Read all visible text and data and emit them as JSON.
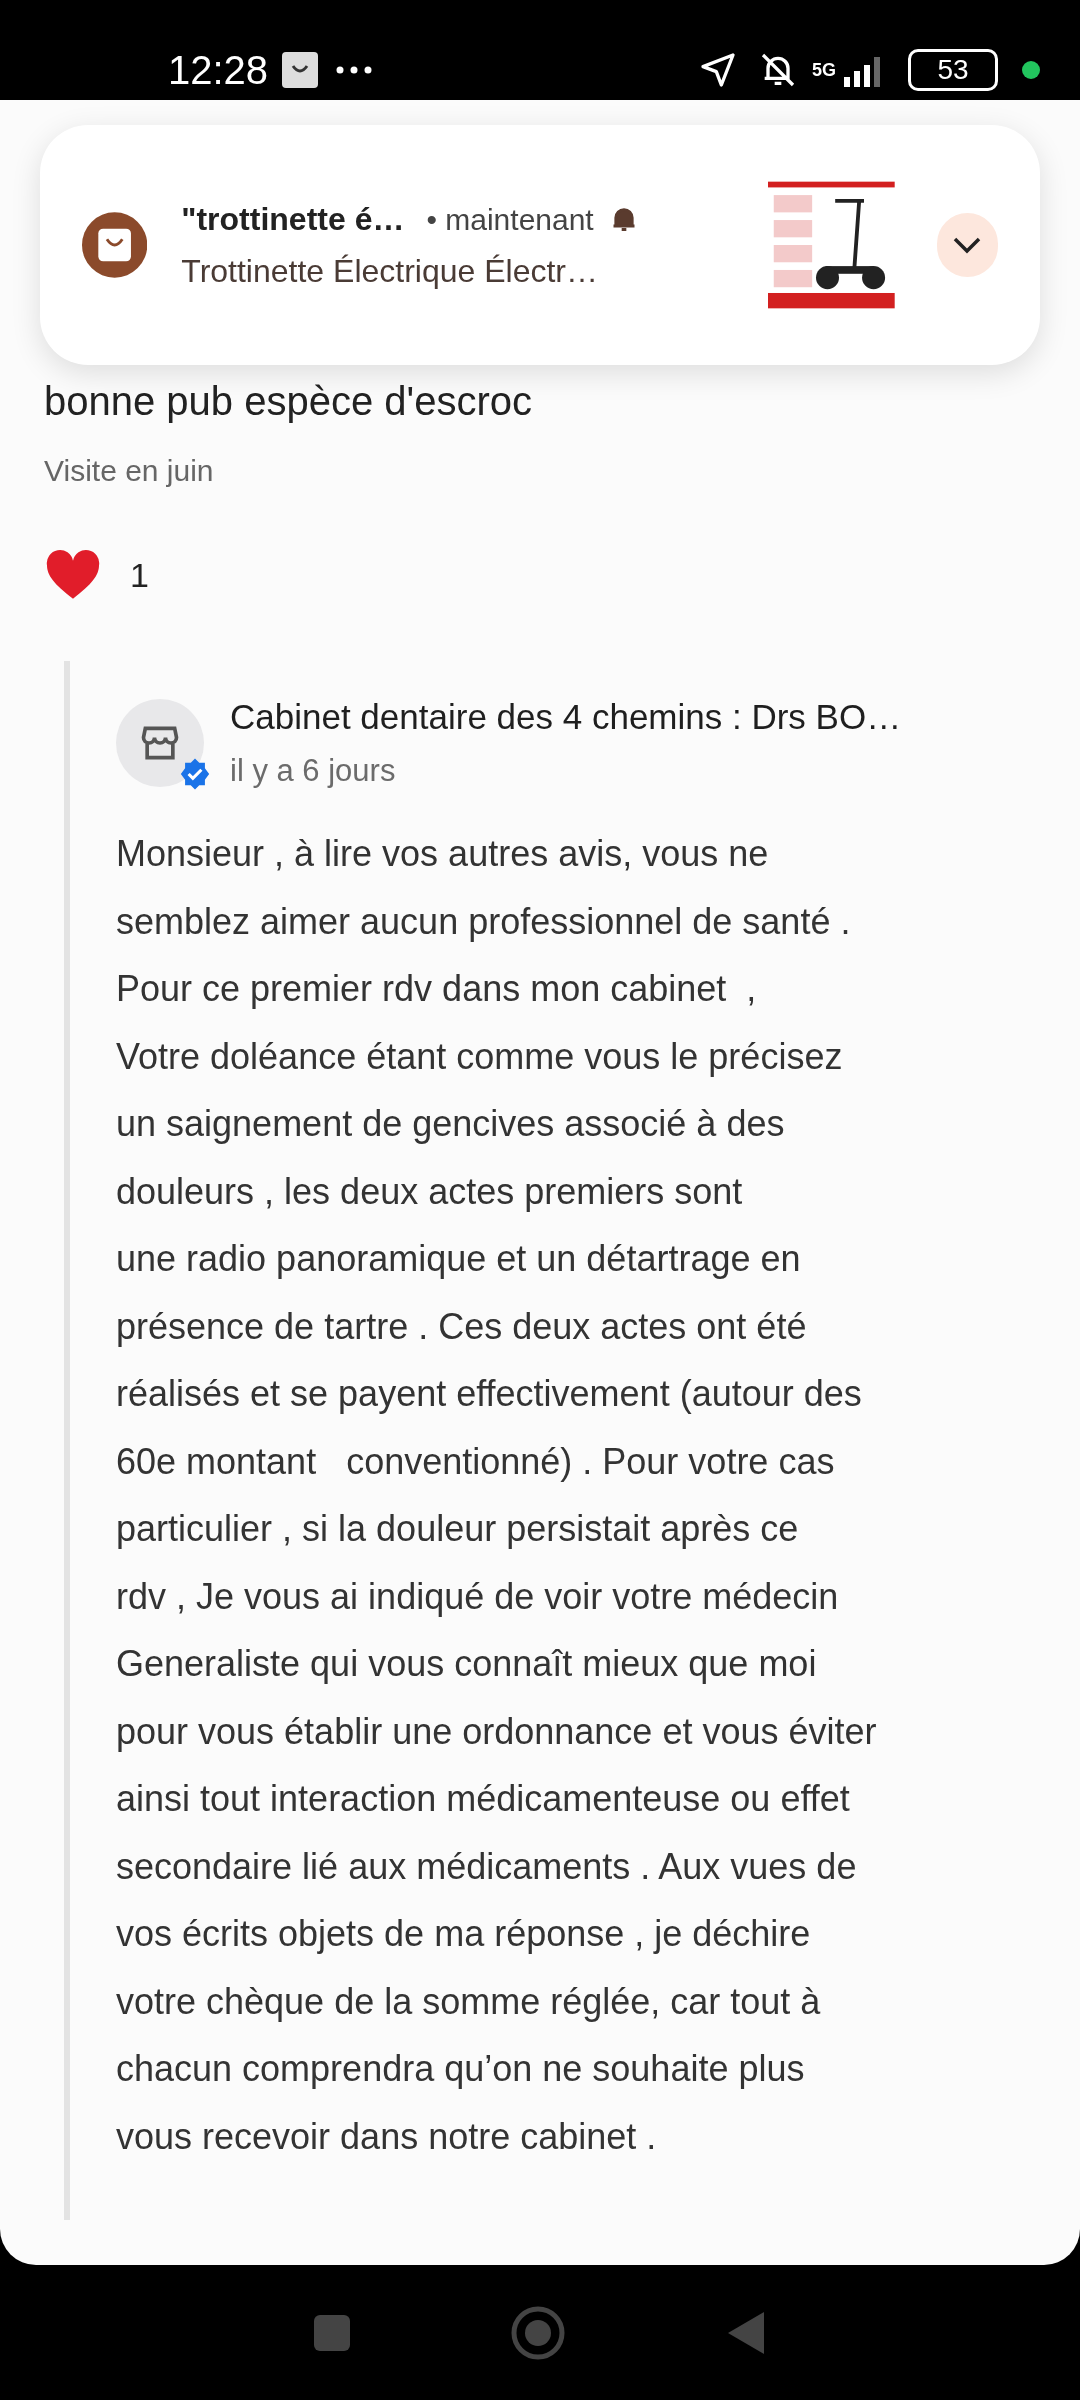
{
  "status_bar": {
    "time": "12:28",
    "network": "5G",
    "battery": "53"
  },
  "notification": {
    "title": "\"trottinette é…",
    "time": "• maintenant",
    "text": "Trottinette Électrique Électr…",
    "expanded": false
  },
  "review": {
    "text_lines": [
      "bonne pub espèce d'escroc"
    ],
    "visit": "Visite en juin",
    "reaction_count": "1"
  },
  "reply": {
    "author": "Cabinet dentaire des 4 chemins : Drs BO…",
    "verified": true,
    "date": "il y a 6 jours",
    "text": "Monsieur , à lire vos autres avis, vous ne\nsemblez aimer aucun professionnel de santé .\nPour ce premier rdv dans mon cabinet  ,\nVotre doléance étant comme vous le précisez\nun saignement de gencives associé à des\ndouleurs , les deux actes premiers sont\nune radio panoramique et un détartrage en\nprésence de tartre . Ces deux actes ont été\nréalisés et se payent effectivement (autour des\n60e montant   conventionné) . Pour votre cas\nparticulier , si la douleur persistait après ce\nrdv , Je vous ai indiqué de voir votre médecin\nGeneraliste qui vous connaît mieux que moi\npour vous établir une ordonnance et vous éviter\nainsi tout interaction médicamenteuse ou effet\nsecondaire lié aux médicaments . Aux vues de\nvos écrits objets de ma réponse , je déchire\nvotre chèque de la somme réglée, car tout à\nchacun comprendra qu’on ne souhaite plus\nvous recevoir dans notre cabinet ."
  }
}
